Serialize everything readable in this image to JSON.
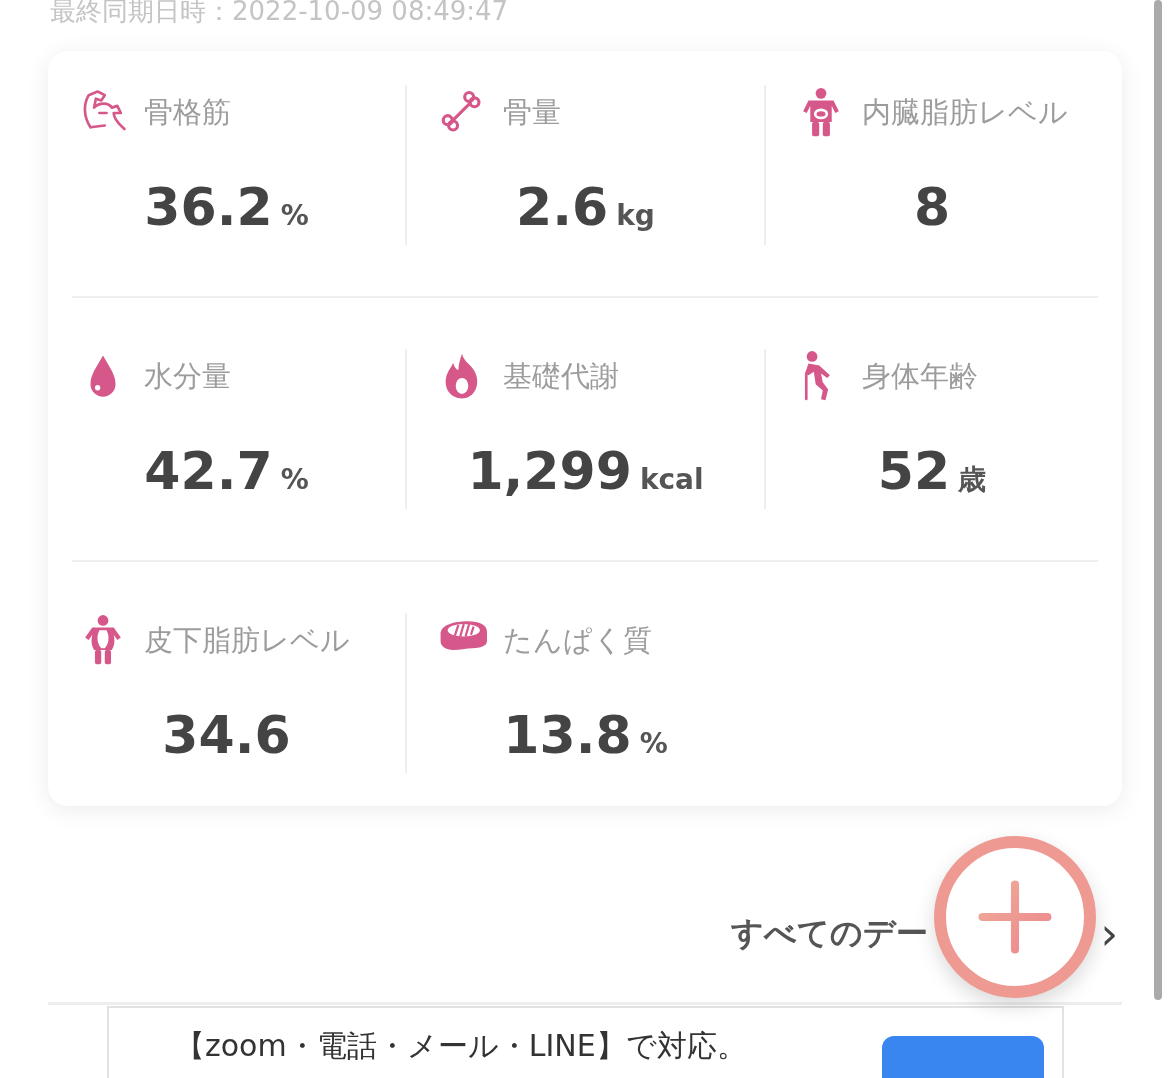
{
  "sync_time": "最終同期日時：2022-10-09 08:49:47",
  "metrics": [
    {
      "kind": "muscle",
      "label": "骨格筋",
      "value": "36.2",
      "unit": "%"
    },
    {
      "kind": "bone",
      "label": "骨量",
      "value": "2.6",
      "unit": "kg"
    },
    {
      "kind": "visceral",
      "label": "内臓脂肪レベル",
      "value": "8"
    },
    {
      "kind": "water",
      "label": "水分量",
      "value": "42.7",
      "unit": "%"
    },
    {
      "kind": "fire",
      "label": "基礎代謝",
      "value": "1,299",
      "unit": "kcal"
    },
    {
      "kind": "elderly",
      "label": "身体年齢",
      "value": "52",
      "unit": "歳"
    },
    {
      "kind": "body",
      "label": "皮下脂肪レベル",
      "value": "34.6"
    },
    {
      "kind": "meat",
      "label": "たんぱく質",
      "value": "13.8",
      "unit": "%"
    }
  ],
  "all_data_link": {
    "label": "すべてのデー",
    "chevron": "›"
  },
  "ad": {
    "text": "【zoom・電話・メール・LINE】で対応。"
  }
}
